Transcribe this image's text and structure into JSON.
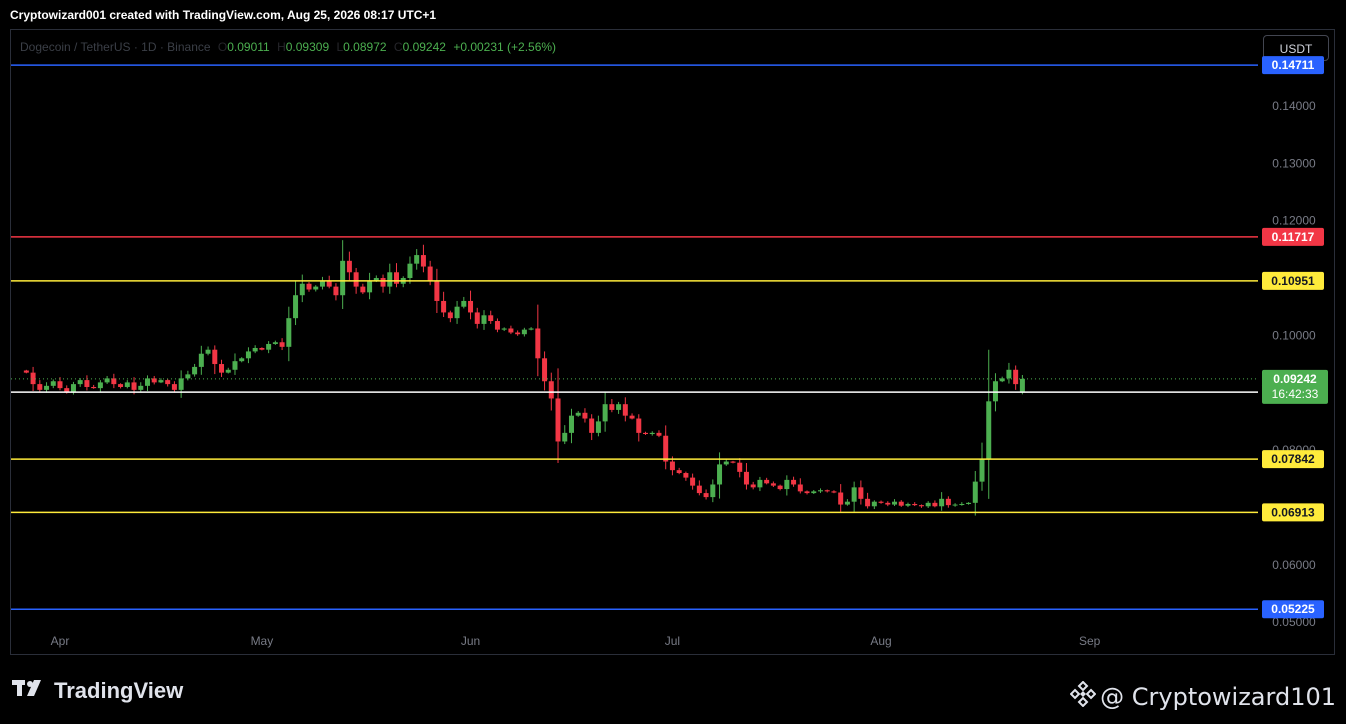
{
  "header": {
    "attribution": "Cryptowizard001 created with TradingView.com, Aug 25, 2026 08:17 UTC+1"
  },
  "legend": {
    "symbol": "Dogecoin / TetherUS · 1D · Binance",
    "o_label": "O",
    "o_value": "0.09011",
    "h_label": "H",
    "h_value": "0.09309",
    "l_label": "L",
    "l_value": "0.08972",
    "c_label": "C",
    "c_value": "0.09242",
    "change": "+0.00231 (+2.56%)"
  },
  "currency_button": "USDT",
  "footer": {
    "brand": "TradingView",
    "author": "@ Cryptowizard101"
  },
  "colors": {
    "up": "#4caf50",
    "down": "#f23645",
    "blue_line": "#2962ff",
    "red_line": "#f23645",
    "yellow_line": "#ffeb3b",
    "white_line": "#ffffff",
    "last_price": "#4caf50"
  },
  "chart_data": {
    "type": "candlestick",
    "title": "Dogecoin / TetherUS · 1D · Binance",
    "ylim": [
      0.0495,
      0.1515
    ],
    "y_ticks": [
      "0.14000",
      "0.13000",
      "0.12000",
      "0.10000",
      "0.08000",
      "0.06000",
      "0.05000"
    ],
    "x_ticks": [
      {
        "label": "Apr",
        "index": 0
      },
      {
        "label": "May",
        "index": 30
      },
      {
        "label": "Jun",
        "index": 61
      },
      {
        "label": "Jul",
        "index": 91
      },
      {
        "label": "Aug",
        "index": 122
      },
      {
        "label": "Sep",
        "index": 153
      }
    ],
    "first_index": -5,
    "horizontal_lines": [
      {
        "value": 0.14711,
        "label": "0.14711",
        "color": "#2962ff"
      },
      {
        "value": 0.11717,
        "label": "0.11717",
        "color": "#f23645"
      },
      {
        "value": 0.10951,
        "label": "0.10951",
        "color": "#ffeb3b"
      },
      {
        "value": 0.0901,
        "label": "0.09010",
        "color": "#ffffff"
      },
      {
        "value": 0.07842,
        "label": "0.07842",
        "color": "#ffeb3b"
      },
      {
        "value": 0.06913,
        "label": "0.06913",
        "color": "#ffeb3b"
      },
      {
        "value": 0.05225,
        "label": "0.05225",
        "color": "#2962ff"
      }
    ],
    "last_price": {
      "value": 0.09242,
      "label": "0.09242",
      "countdown": "16:42:33"
    },
    "closes": [
      0.0935,
      0.0915,
      0.0905,
      0.0912,
      0.092,
      0.0908,
      0.0902,
      0.0915,
      0.0922,
      0.091,
      0.0908,
      0.0918,
      0.0925,
      0.0915,
      0.091,
      0.0918,
      0.0905,
      0.0912,
      0.0925,
      0.0918,
      0.0922,
      0.0915,
      0.0905,
      0.0925,
      0.0932,
      0.0945,
      0.0968,
      0.0975,
      0.095,
      0.0935,
      0.094,
      0.0955,
      0.096,
      0.0972,
      0.0978,
      0.0975,
      0.0985,
      0.0988,
      0.098,
      0.103,
      0.107,
      0.109,
      0.108,
      0.1085,
      0.1095,
      0.1085,
      0.107,
      0.113,
      0.111,
      0.1085,
      0.1075,
      0.1095,
      0.11,
      0.1085,
      0.111,
      0.109,
      0.11,
      0.1125,
      0.114,
      0.112,
      0.1095,
      0.106,
      0.104,
      0.103,
      0.105,
      0.106,
      0.104,
      0.102,
      0.1035,
      0.1025,
      0.101,
      0.1012,
      0.1005,
      0.1002,
      0.101,
      0.1012,
      0.096,
      0.092,
      0.089,
      0.0815,
      0.083,
      0.086,
      0.0865,
      0.0855,
      0.083,
      0.085,
      0.088,
      0.087,
      0.088,
      0.086,
      0.0855,
      0.083,
      0.0828,
      0.083,
      0.0825,
      0.078,
      0.0765,
      0.076,
      0.0752,
      0.0738,
      0.0725,
      0.0718,
      0.074,
      0.0775,
      0.078,
      0.0778,
      0.0762,
      0.074,
      0.0735,
      0.0748,
      0.0742,
      0.0738,
      0.0732,
      0.0748,
      0.074,
      0.0728,
      0.0725,
      0.0728,
      0.073,
      0.0728,
      0.0726,
      0.0705,
      0.071,
      0.0735,
      0.0715,
      0.0702,
      0.071,
      0.0708,
      0.0705,
      0.071,
      0.0703,
      0.0706,
      0.0704,
      0.0702,
      0.0708,
      0.0702,
      0.0715,
      0.0704,
      0.0705,
      0.0706,
      0.0708,
      0.0745,
      0.0785,
      0.0885,
      0.092,
      0.0925,
      0.094,
      0.0915,
      0.09242
    ],
    "last_ohlc": {
      "open": 0.09011,
      "high": 0.09309,
      "low": 0.08972,
      "close": 0.09242
    }
  }
}
